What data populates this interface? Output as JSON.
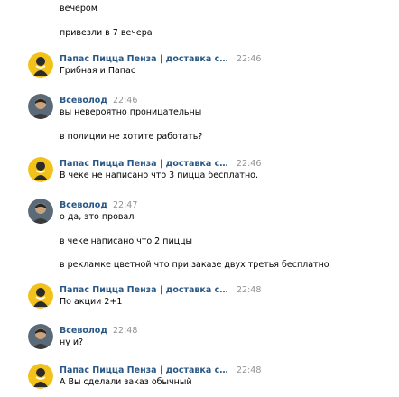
{
  "top_lines": [
    "вечером",
    "привезли в 7 вечера"
  ],
  "papas_name": "Папас Пицца Пенза | доставка сочной …",
  "vsevolod_name": "Всеволод",
  "messages": [
    {
      "author": "papas",
      "time": "22:46",
      "lines": [
        "Грибная и Папас"
      ]
    },
    {
      "author": "vsevolod",
      "time": "22:46",
      "lines": [
        "вы невероятно проницательны",
        "в полиции не хотите работать?"
      ]
    },
    {
      "author": "papas",
      "time": "22:46",
      "lines": [
        "В чеке не написано что 3 пицца бесплатно."
      ]
    },
    {
      "author": "vsevolod",
      "time": "22:47",
      "lines": [
        "о да, это провал",
        "в чеке написано что 2 пиццы",
        "в рекламке цветной что при заказе двух третья бесплатно"
      ]
    },
    {
      "author": "papas",
      "time": "22:48",
      "lines": [
        "По акции 2+1"
      ]
    },
    {
      "author": "vsevolod",
      "time": "22:48",
      "lines": [
        "ну и?"
      ]
    },
    {
      "author": "papas",
      "time": "22:48",
      "lines": [
        "А Вы сделали заказ обычный"
      ]
    }
  ],
  "colors": {
    "author": "#2a5885",
    "time": "#939393",
    "papas_avatar_bg": "#f2c21a",
    "vsevolod_avatar_bg": "#5a6a78"
  },
  "icons": {
    "papas_avatar": "papas-logo-avatar",
    "vsevolod_avatar": "user-photo-avatar"
  }
}
